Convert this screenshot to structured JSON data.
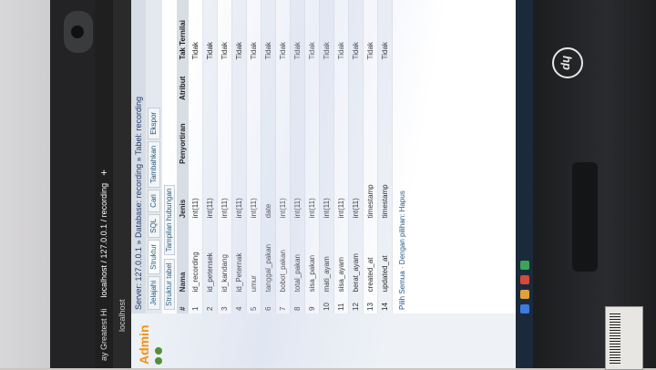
{
  "browser": {
    "tabs": [
      {
        "label": "ay Greatest Hi"
      },
      {
        "label": "localhost / 127.0.0.1 / recording"
      }
    ],
    "url": "localhost"
  },
  "app": {
    "brand": "Admin"
  },
  "breadcrumb": {
    "server": "Server: 127.0.0.1",
    "database": "Database: recording",
    "table": "Tabel: recording"
  },
  "menu_tabs": [
    "Jelajahi",
    "Struktur",
    "SQL",
    "Cari",
    "Tambahkan",
    "Ekspor"
  ],
  "sub_tabs": [
    "Struktur tabel",
    "Tampilan hubungan"
  ],
  "table": {
    "headers": [
      "#",
      "Nama",
      "Jenis",
      "Penyortiran",
      "Atribut",
      "Tak Ternilai"
    ],
    "rows": [
      [
        "1",
        "id_recording",
        "int(11)",
        "",
        "",
        "Tidak"
      ],
      [
        "2",
        "id_petensek",
        "int(11)",
        "",
        "",
        "Tidak"
      ],
      [
        "3",
        "id_kandang",
        "int(11)",
        "",
        "",
        "Tidak"
      ],
      [
        "4",
        "id_Peternak",
        "int(11)",
        "",
        "",
        "Tidak"
      ],
      [
        "5",
        "umur",
        "int(11)",
        "",
        "",
        "Tidak"
      ],
      [
        "6",
        "tanggal_pakan",
        "date",
        "",
        "",
        "Tidak"
      ],
      [
        "7",
        "bobot_pakan",
        "int(11)",
        "",
        "",
        "Tidak"
      ],
      [
        "8",
        "total_pakan",
        "int(11)",
        "",
        "",
        "Tidak"
      ],
      [
        "9",
        "sisa_pakan",
        "int(11)",
        "",
        "",
        "Tidak"
      ],
      [
        "10",
        "mati_ayam",
        "int(11)",
        "",
        "",
        "Tidak"
      ],
      [
        "11",
        "sisa_ayam",
        "int(11)",
        "",
        "",
        "Tidak"
      ],
      [
        "12",
        "berat_ayam",
        "int(11)",
        "",
        "",
        "Tidak"
      ],
      [
        "13",
        "created_at",
        "timestamp",
        "",
        "",
        "Tidak"
      ],
      [
        "14",
        "updated_at",
        "timestamp",
        "",
        "",
        "Tidak"
      ]
    ]
  },
  "actions": {
    "check_all": "Pilih Semua",
    "with_selected": "Dengan pilihan:",
    "delete": "Hapus"
  },
  "device": {
    "logo": "hp"
  }
}
